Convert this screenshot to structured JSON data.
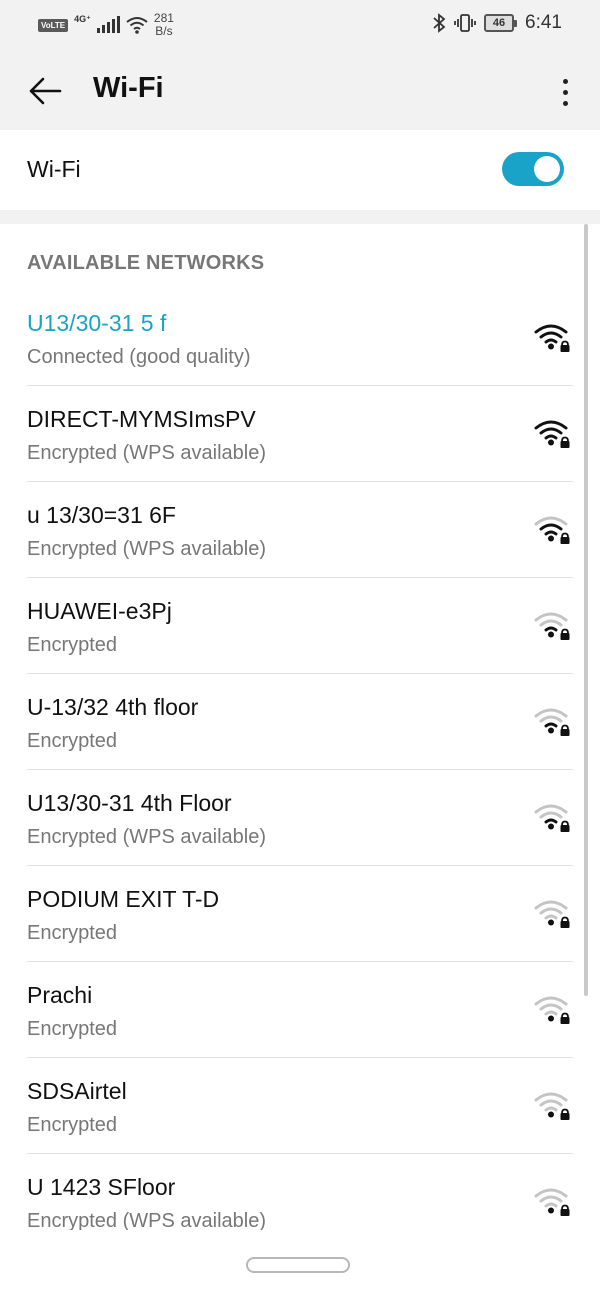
{
  "status_bar": {
    "volte": "VoLTE",
    "network_type": "4G⁺",
    "speed_value": "281",
    "speed_unit": "B/s",
    "battery": "46",
    "time": "6:41"
  },
  "app_bar": {
    "title": "Wi-Fi"
  },
  "wifi_toggle": {
    "label": "Wi-Fi",
    "enabled": true
  },
  "networks": {
    "header": "AVAILABLE NETWORKS",
    "items": [
      {
        "name": "U13/30-31 5 f",
        "status": "Connected (good quality)",
        "connected": true,
        "signal": 4
      },
      {
        "name": "DIRECT-MYMSImsPV",
        "status": "Encrypted (WPS available)",
        "connected": false,
        "signal": 4
      },
      {
        "name": "u 13/30=31 6F",
        "status": "Encrypted (WPS available)",
        "connected": false,
        "signal": 3
      },
      {
        "name": "HUAWEI-e3Pj",
        "status": "Encrypted",
        "connected": false,
        "signal": 2
      },
      {
        "name": "U-13/32 4th floor",
        "status": "Encrypted",
        "connected": false,
        "signal": 2
      },
      {
        "name": "U13/30-31 4th Floor",
        "status": "Encrypted (WPS available)",
        "connected": false,
        "signal": 2
      },
      {
        "name": "PODIUM EXIT T-D",
        "status": "Encrypted",
        "connected": false,
        "signal": 1
      },
      {
        "name": "Prachi",
        "status": "Encrypted",
        "connected": false,
        "signal": 1
      },
      {
        "name": "SDSAirtel",
        "status": "Encrypted",
        "connected": false,
        "signal": 1
      },
      {
        "name": "U 1423 SFloor",
        "status": "Encrypted (WPS available)",
        "connected": false,
        "signal": 1
      }
    ]
  },
  "colors": {
    "accent": "#1aa3c9",
    "icon_active": "#111111",
    "icon_inactive": "#c4c4c4"
  }
}
